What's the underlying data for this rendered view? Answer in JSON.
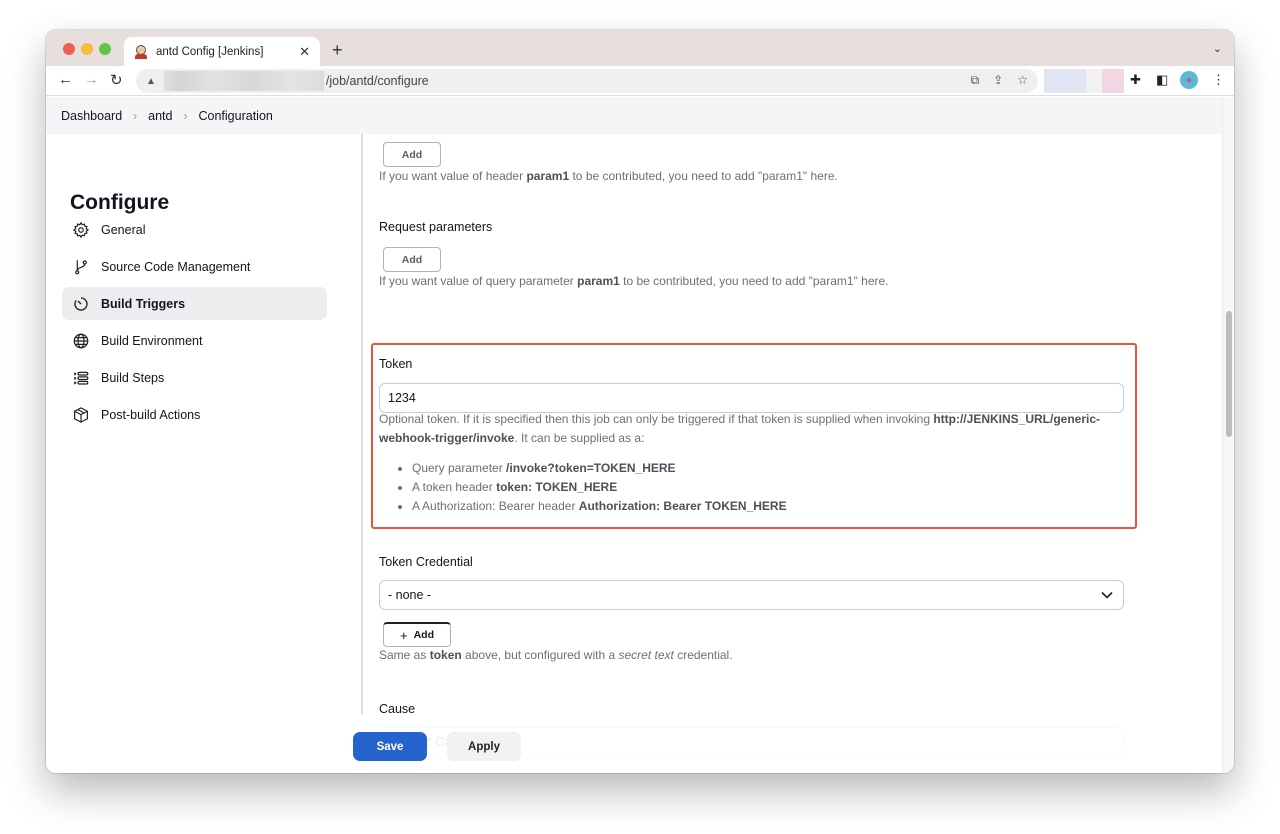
{
  "browser": {
    "tab_title": "antd Config [Jenkins]",
    "tab_close": "✕",
    "new_tab": "+",
    "tab_menu": "⌄",
    "url_path": "/job/antd/configure",
    "icons": {
      "back": "←",
      "forward": "→",
      "reload": "↻",
      "warning": "▲",
      "translate": "⧉",
      "share": "⇪",
      "bookmark": "☆",
      "extensions": "✚",
      "sidepanel": "◧",
      "menu": "⋮"
    }
  },
  "breadcrumb": {
    "items": [
      "Dashboard",
      "antd",
      "Configuration"
    ],
    "separator": "›"
  },
  "page": {
    "title": "Configure"
  },
  "sidebar": {
    "items": [
      {
        "label": "General",
        "icon": "gear-icon",
        "active": false
      },
      {
        "label": "Source Code Management",
        "icon": "git-branch-icon",
        "active": false
      },
      {
        "label": "Build Triggers",
        "icon": "timer-icon",
        "active": true
      },
      {
        "label": "Build Environment",
        "icon": "globe-icon",
        "active": false
      },
      {
        "label": "Build Steps",
        "icon": "list-icon",
        "active": false
      },
      {
        "label": "Post-build Actions",
        "icon": "package-icon",
        "active": false
      }
    ]
  },
  "form": {
    "header_params": {
      "add_label": "Add",
      "help_prefix": "If you want value of header ",
      "help_bold": "param1",
      "help_suffix": " to be contributed, you need to add \"param1\" here."
    },
    "request_params": {
      "label": "Request parameters",
      "add_label": "Add",
      "help_prefix": "If you want value of query parameter ",
      "help_bold": "param1",
      "help_suffix": " to be contributed, you need to add \"param1\" here."
    },
    "token": {
      "label": "Token",
      "value": "1234",
      "help_prefix": "Optional token. If it is specified then this job can only be triggered if that token is supplied when invoking ",
      "help_bold": "http://JENKINS_URL/generic-webhook-trigger/invoke",
      "help_suffix": ". It can be supplied as a:",
      "options": [
        {
          "prefix": "Query parameter ",
          "bold": "/invoke?token=TOKEN_HERE"
        },
        {
          "prefix": "A token header ",
          "bold": "token: TOKEN_HERE"
        },
        {
          "prefix": "A Authorization: Bearer header ",
          "bold": "Authorization: Bearer TOKEN_HERE"
        }
      ],
      "highlight_color": "#e2583b"
    },
    "token_credential": {
      "label": "Token Credential",
      "selected": "- none -",
      "add_label": "Add",
      "help_prefix": "Same as ",
      "help_bold": "token",
      "help_middle": " above, but configured with a ",
      "help_italic": "secret text",
      "help_suffix": " credential."
    },
    "cause": {
      "label": "Cause",
      "value": "Generic Cause"
    }
  },
  "actions": {
    "save_label": "Save",
    "apply_label": "Apply",
    "save_color": "#2464cc"
  }
}
